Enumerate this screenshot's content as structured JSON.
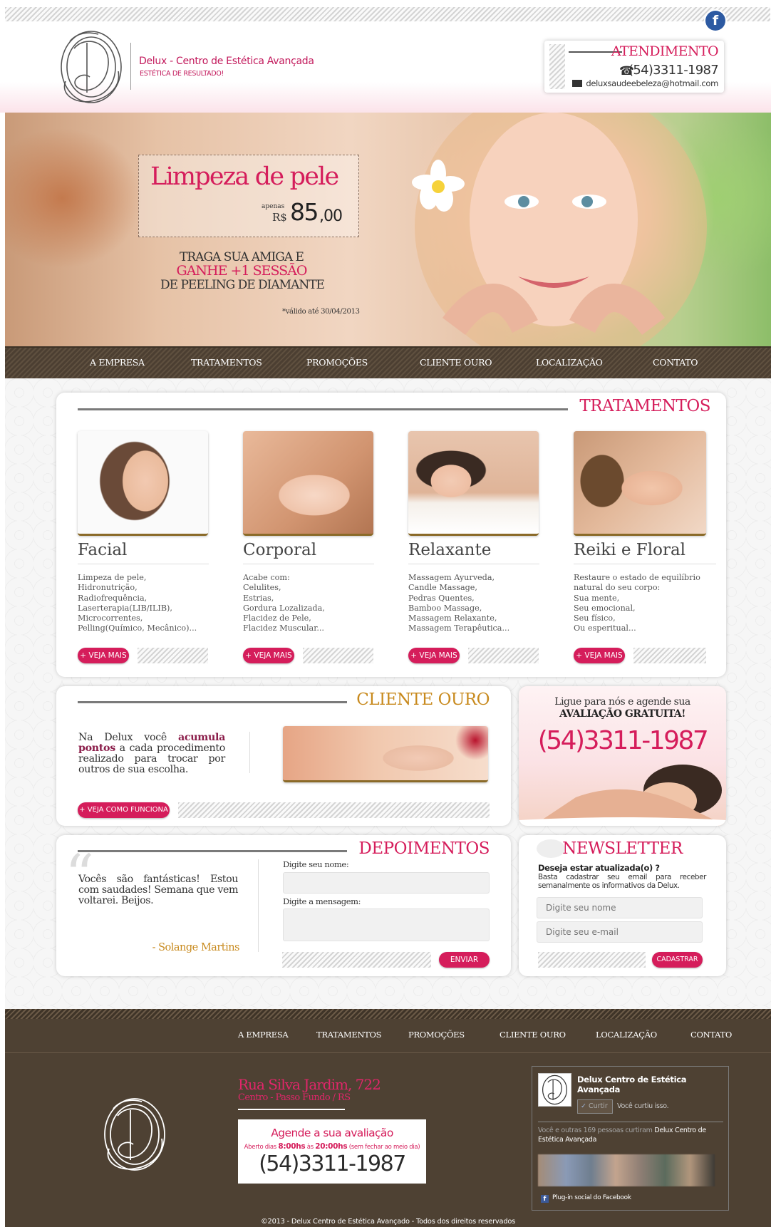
{
  "header": {
    "brand_name": "Delux - Centro de Estética Avançada",
    "brand_tagline": "ESTÉTICA DE RESULTADO!",
    "attendance_label": "ATENDIMENTO",
    "phone": "(54)3311-1987",
    "email": "deluxsaudeebeleza@hotmail.com",
    "facebook_icon": "facebook-icon"
  },
  "banner": {
    "title": "Limpeza de pele",
    "price_prefix": "apenas",
    "currency": "R$",
    "price_int": "85",
    "price_dec": ",00",
    "promo_line1": "TRAGA SUA AMIGA E",
    "promo_line2": "GANHE  +1 SESSÃO",
    "promo_line3": "DE PEELING DE DIAMANTE",
    "validity": "*válido até 30/04/2013"
  },
  "nav": [
    "A EMPRESA",
    "TRATAMENTOS",
    "PROMOÇÕES",
    "CLIENTE OURO",
    "LOCALIZAÇÃO",
    "CONTATO"
  ],
  "tratamentos": {
    "title": "TRATAMENTOS",
    "cards": [
      {
        "title": "Facial",
        "items": [
          "Limpeza de pele,",
          "Hidronutrição,",
          "Radiofrequência,",
          "Laserterapia(LIB/ILIB),",
          "Microcorrentes,",
          "Pelling(Químico, Mecânico)..."
        ],
        "button": "+ VEJA MAIS"
      },
      {
        "title": "Corporal",
        "items": [
          "Acabe com:",
          "Celulites,",
          "Estrias,",
          "Gordura Lozalizada,",
          "Flacidez de Pele,",
          "Flacidez Muscular..."
        ],
        "button": "+ VEJA MAIS"
      },
      {
        "title": "Relaxante",
        "items": [
          "Massagem Ayurveda,",
          "Candle Massage,",
          "Pedras Quentes,",
          "Bamboo Massage,",
          "Massagem Relaxante,",
          "Massagem Terapêutica..."
        ],
        "button": "+ VEJA MAIS"
      },
      {
        "title": "Reiki e Floral",
        "items": [
          "Restaure o estado de equilíbrio",
          "natural do seu corpo:",
          "Sua mente,",
          "Seu emocional,",
          "Seu físico,",
          "Ou esperitual..."
        ],
        "button": "+ VEJA MAIS"
      }
    ]
  },
  "cliente_ouro": {
    "title": "CLIENTE OURO",
    "text_a": "Na Delux você ",
    "text_b": "acumula pontos",
    "text_c": " a cada procedimento realizado para trocar por outros de sua escolha.",
    "button": "+ VEJA COMO FUNCIONA"
  },
  "cta": {
    "line1": "Ligue para nós e agende sua",
    "line2": "AVALIAÇÃO GRATUITA!",
    "phone": "(54)3311-1987"
  },
  "depoimentos": {
    "title": "DEPOIMENTOS",
    "quote": "Vocês são fantásticas! Estou com saudades! Semana que vem voltarei. Beijos.",
    "author": "- Solange Martins",
    "name_label": "Digite seu nome:",
    "message_label": "Digite a mensagem:",
    "submit": "ENVIAR"
  },
  "newsletter": {
    "title": "NEWSLETTER",
    "question": "Deseja estar atualizada(o) ?",
    "desc": "Basta cadastrar seu email para receber semanalmente os informativos da Delux.",
    "name_placeholder": "Digite seu nome",
    "email_placeholder": "Digite seu e-mail",
    "submit": "CADASTRAR"
  },
  "footer": {
    "nav": [
      "A EMPRESA",
      "TRATAMENTOS",
      "PROMOÇÕES",
      "CLIENTE OURO",
      "LOCALIZAÇÃO",
      "CONTATO"
    ],
    "address": "Rua Silva Jardim, 722",
    "city": "Centro - Passo Fundo / RS",
    "agende": "Agende a sua avaliação",
    "hours_a": "Aberto dias ",
    "hours_b": "8:00hs",
    "hours_c": " às ",
    "hours_d": "20:00hs",
    "hours_e": " (sem fechar ao meio dia)",
    "phone": "(54)3311-1987",
    "copyright": "©2013 - Delux Centro de Estética Avançado - Todos dos direitos reservados"
  },
  "facebook": {
    "page_name": "Delux Centro de Estética Avançada",
    "like": "Curtir",
    "liked": "Você curtiu isso.",
    "social_a": "Você e outras 169 pessoas curtiram ",
    "social_b": "Delux Centro de Estética Avançada",
    "plugin": "Plug-in social do Facebook"
  },
  "colors": {
    "accent": "#d51d5b",
    "gold": "#c88a1e",
    "brown": "#4e4133"
  }
}
